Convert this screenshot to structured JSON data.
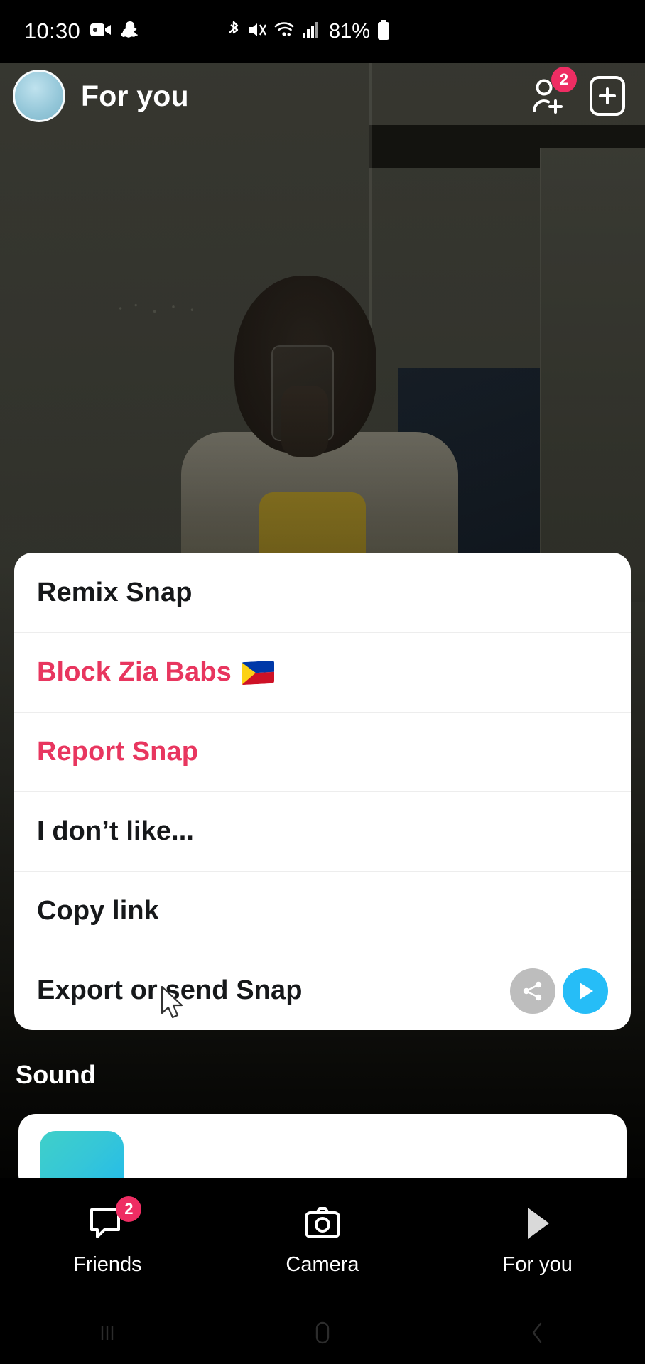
{
  "status_bar": {
    "time": "10:30",
    "battery_percent": "81%",
    "icons": [
      "camera-recording-icon",
      "snapchat-ghost-icon",
      "bluetooth-icon",
      "mute-icon",
      "wifi-icon",
      "cellular-signal-icon",
      "battery-icon"
    ]
  },
  "header": {
    "title": "For you",
    "avatar_name": "profile-avatar",
    "add_friend_badge": "2",
    "add_icon": "add-friend-icon",
    "create_icon": "add-snap-icon"
  },
  "action_sheet": {
    "items": [
      {
        "label": "Remix Snap",
        "style": "normal",
        "name": "remix-snap"
      },
      {
        "label": "Block Zia Babs",
        "style": "destructive",
        "name": "block-user",
        "flag": "philippines-flag-emoji"
      },
      {
        "label": "Report Snap",
        "style": "destructive",
        "name": "report-snap"
      },
      {
        "label": "I don’t like...",
        "style": "normal",
        "name": "i-dont-like"
      },
      {
        "label": "Copy link",
        "style": "normal",
        "name": "copy-link"
      },
      {
        "label": "Export or send Snap",
        "style": "normal",
        "name": "export-or-send-snap"
      }
    ],
    "share_button": "share-icon",
    "send_button": "send-icon"
  },
  "sound_section": {
    "title": "Sound"
  },
  "bottom_nav": {
    "items": [
      {
        "label": "Friends",
        "icon": "chat-bubble-icon",
        "badge": "2",
        "active": false
      },
      {
        "label": "Camera",
        "icon": "camera-icon",
        "badge": "",
        "active": false
      },
      {
        "label": "For you",
        "icon": "play-triangle-icon",
        "badge": "",
        "active": true
      }
    ]
  },
  "android_nav": {
    "recents": "recents-icon",
    "home": "home-icon",
    "back": "back-icon"
  },
  "colors": {
    "accent_pink": "#EE2D63",
    "destructive": "#E8365F",
    "send_blue": "#26BDF7",
    "share_grey": "#BDBDBD",
    "sheet_bg": "#FFFFFF"
  }
}
